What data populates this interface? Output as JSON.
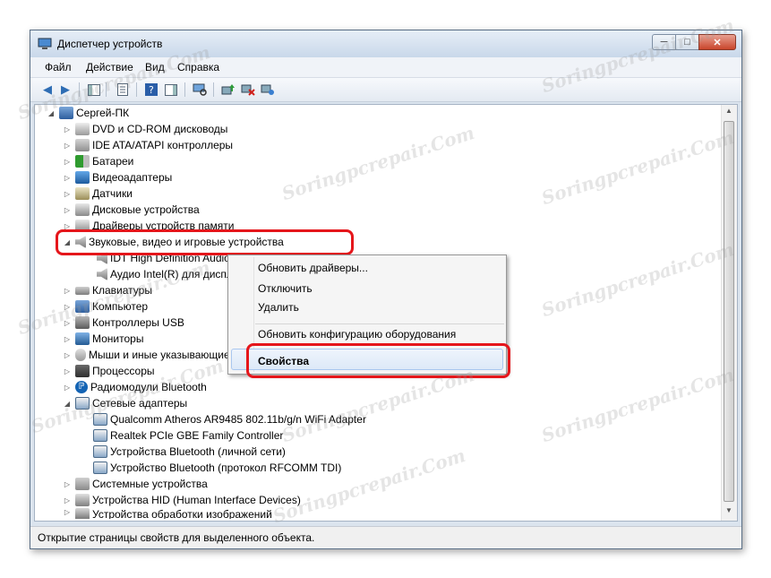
{
  "window": {
    "title": "Диспетчер устройств"
  },
  "menu": [
    "Файл",
    "Действие",
    "Вид",
    "Справка"
  ],
  "tree": {
    "root": "Сергей-ПК",
    "items": [
      {
        "label": "DVD и CD-ROM дисководы",
        "icon": "disk-drive-icon"
      },
      {
        "label": "IDE ATA/ATAPI контроллеры",
        "icon": "ide-controller-icon"
      },
      {
        "label": "Батареи",
        "icon": "battery-icon"
      },
      {
        "label": "Видеоадаптеры",
        "icon": "display-adapter-icon"
      },
      {
        "label": "Датчики",
        "icon": "sensor-icon"
      },
      {
        "label": "Дисковые устройства",
        "icon": "hard-drive-icon"
      },
      {
        "label": "Драйверы устройств памяти",
        "icon": "memory-driver-icon"
      },
      {
        "label": "Звуковые, видео и игровые устройства",
        "icon": "speaker-icon"
      },
      {
        "label": "IDT High Definition Audio CODEC",
        "icon": "speaker-icon"
      },
      {
        "label": "Аудио Intel(R) для дисплеев",
        "icon": "speaker-icon"
      },
      {
        "label": "Клавиатуры",
        "icon": "keyboard-icon"
      },
      {
        "label": "Компьютер",
        "icon": "computer-icon"
      },
      {
        "label": "Контроллеры USB",
        "icon": "usb-icon"
      },
      {
        "label": "Мониторы",
        "icon": "monitor-icon"
      },
      {
        "label": "Мыши и иные указывающие устройства",
        "icon": "mouse-icon"
      },
      {
        "label": "Процессоры",
        "icon": "cpu-icon"
      },
      {
        "label": "Радиомодули Bluetooth",
        "icon": "bluetooth-icon"
      },
      {
        "label": "Сетевые адаптеры",
        "icon": "network-adapter-icon"
      },
      {
        "label": "Qualcomm Atheros AR9485 802.11b/g/n WiFi Adapter",
        "icon": "network-adapter-icon"
      },
      {
        "label": "Realtek PCIe GBE Family Controller",
        "icon": "network-adapter-icon"
      },
      {
        "label": "Устройства Bluetooth (личной сети)",
        "icon": "network-adapter-icon"
      },
      {
        "label": "Устройство Bluetooth (протокол RFCOMM TDI)",
        "icon": "network-adapter-icon"
      },
      {
        "label": "Системные устройства",
        "icon": "system-device-icon"
      },
      {
        "label": "Устройства HID (Human Interface Devices)",
        "icon": "hid-icon"
      },
      {
        "label": "Устройства обработки изображений",
        "icon": "imaging-device-icon"
      }
    ]
  },
  "context_menu": {
    "update_drivers": "Обновить драйверы...",
    "disable": "Отключить",
    "uninstall": "Удалить",
    "scan_hardware": "Обновить конфигурацию оборудования",
    "properties": "Свойства"
  },
  "status": {
    "text": "Открытие страницы свойств для выделенного объекта."
  },
  "watermark": "Soringpcrepair.Com",
  "colors": {
    "highlight": "#e5161b",
    "accent": "#1e5c9e"
  }
}
